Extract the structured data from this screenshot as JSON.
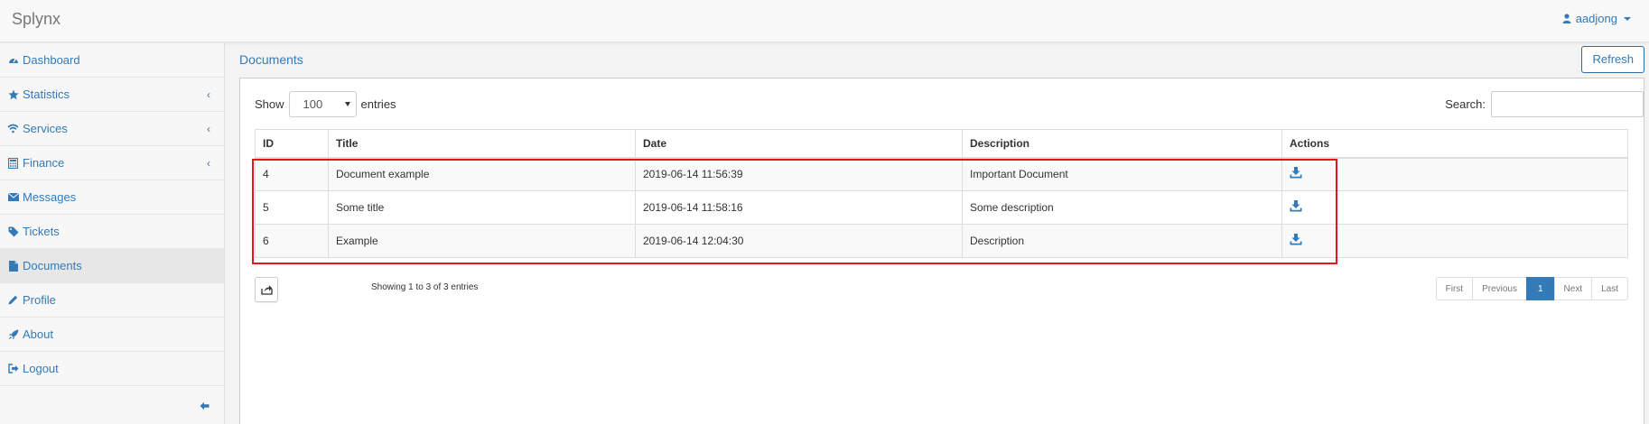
{
  "app": {
    "brand": "Splynx"
  },
  "user": {
    "name": "aadjong"
  },
  "sidebar": {
    "items": [
      {
        "label": "Dashboard",
        "icon": "dashboard-icon",
        "has_submenu": false
      },
      {
        "label": "Statistics",
        "icon": "star-icon",
        "has_submenu": true
      },
      {
        "label": "Services",
        "icon": "wifi-icon",
        "has_submenu": true
      },
      {
        "label": "Finance",
        "icon": "calculator-icon",
        "has_submenu": true
      },
      {
        "label": "Messages",
        "icon": "envelope-icon",
        "has_submenu": false
      },
      {
        "label": "Tickets",
        "icon": "tags-icon",
        "has_submenu": false
      },
      {
        "label": "Documents",
        "icon": "file-icon",
        "has_submenu": false,
        "active": true
      },
      {
        "label": "Profile",
        "icon": "pencil-icon",
        "has_submenu": false
      },
      {
        "label": "About",
        "icon": "rocket-icon",
        "has_submenu": false
      },
      {
        "label": "Logout",
        "icon": "sign-out-icon",
        "has_submenu": false
      }
    ]
  },
  "page": {
    "title": "Documents",
    "refresh_label": "Refresh"
  },
  "table_controls": {
    "show_label": "Show",
    "entries_value": "100",
    "entries_label": "entries",
    "search_label": "Search:",
    "search_value": ""
  },
  "table": {
    "columns": [
      "ID",
      "Title",
      "Date",
      "Description",
      "Actions"
    ],
    "rows": [
      {
        "id": "4",
        "title": "Document example",
        "date": "2019-06-14 11:56:39",
        "description": "Important Document"
      },
      {
        "id": "5",
        "title": "Some title",
        "date": "2019-06-14 11:58:16",
        "description": "Some description"
      },
      {
        "id": "6",
        "title": "Example",
        "date": "2019-06-14 12:04:30",
        "description": "Description"
      }
    ]
  },
  "footer": {
    "info": "Showing 1 to 3 of 3 entries",
    "pagination": {
      "first": "First",
      "previous": "Previous",
      "current": "1",
      "next": "Next",
      "last": "Last"
    }
  },
  "colors": {
    "accent": "#337ab7",
    "highlight": "#e8141b"
  }
}
